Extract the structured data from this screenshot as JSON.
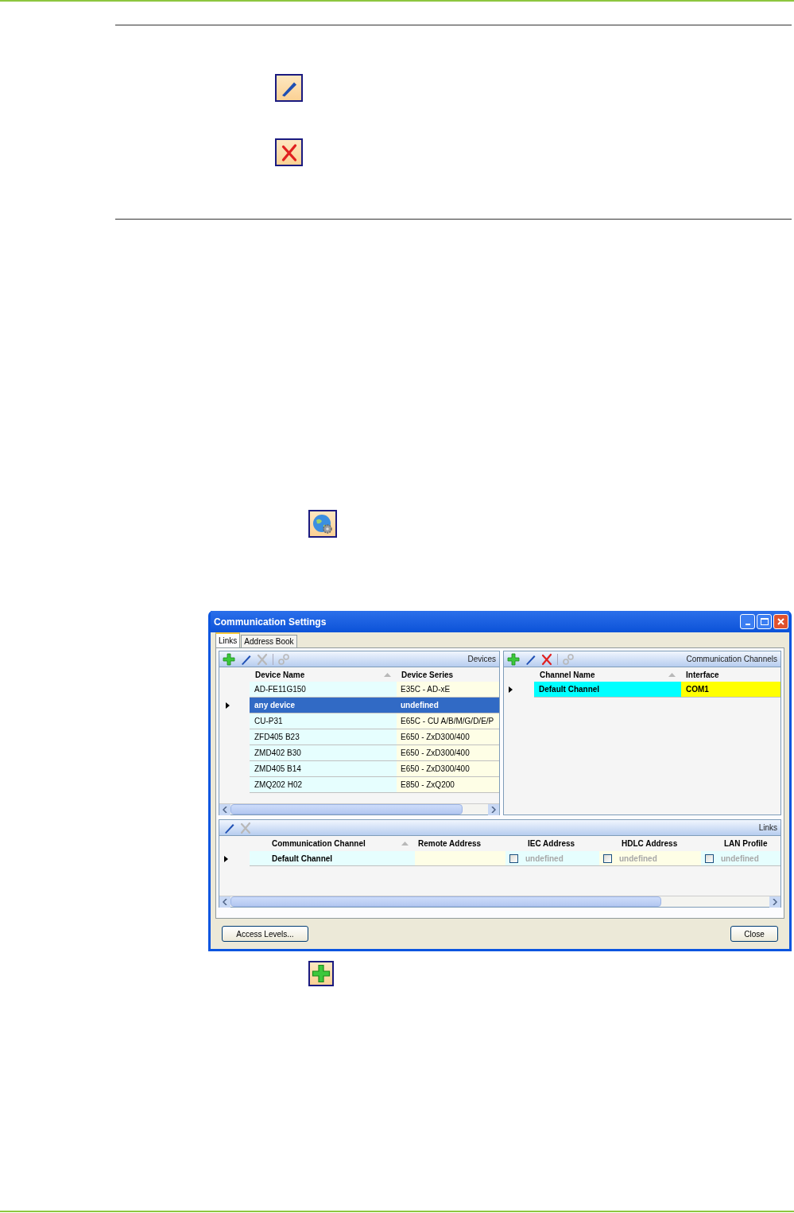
{
  "window": {
    "title": "Communication Settings"
  },
  "tabs": [
    {
      "label": "Links",
      "selected": true
    },
    {
      "label": "Address Book",
      "selected": false
    }
  ],
  "devices": {
    "title": "Devices",
    "toolbar": [
      {
        "kind": "add",
        "disabled": false
      },
      {
        "kind": "edit",
        "disabled": false
      },
      {
        "kind": "delete",
        "disabled": true
      },
      {
        "kind": "link",
        "disabled": true
      }
    ],
    "columns": [
      "Device Name",
      "Device Series"
    ],
    "rows": [
      {
        "name": "AD-FE11G150",
        "series": "E35C - AD-xE",
        "current": false,
        "selected": false
      },
      {
        "name": "any device",
        "series": "undefined",
        "current": true,
        "selected": true
      },
      {
        "name": "CU-P31",
        "series": "E65C - CU A/B/M/G/D/E/P",
        "current": false,
        "selected": false
      },
      {
        "name": "ZFD405 B23",
        "series": "E650 - ZxD300/400",
        "current": false,
        "selected": false
      },
      {
        "name": "ZMD402 B30",
        "series": "E650 - ZxD300/400",
        "current": false,
        "selected": false
      },
      {
        "name": "ZMD405 B14",
        "series": "E650 - ZxD300/400",
        "current": false,
        "selected": false
      },
      {
        "name": "ZMQ202 H02",
        "series": "E850 - ZxQ200",
        "current": false,
        "selected": false
      }
    ]
  },
  "channels": {
    "title": "Communication Channels",
    "toolbar": [
      {
        "kind": "add",
        "disabled": false
      },
      {
        "kind": "edit",
        "disabled": false
      },
      {
        "kind": "delete",
        "disabled": false
      },
      {
        "kind": "link",
        "disabled": true
      }
    ],
    "columns": [
      "Channel Name",
      "Interface"
    ],
    "rows": [
      {
        "name": "Default Channel",
        "interface": "COM1",
        "current": true,
        "selected": false
      }
    ]
  },
  "links": {
    "title": "Links",
    "toolbar": [
      {
        "kind": "edit",
        "disabled": false
      },
      {
        "kind": "delete",
        "disabled": true
      }
    ],
    "columns": [
      "Communication Channel",
      "Remote Address",
      "IEC Address",
      "HDLC Address",
      "LAN Profile"
    ],
    "rows": [
      {
        "channel": "Default Channel",
        "current": true,
        "iec": {
          "checked": false,
          "value": "undefined"
        },
        "hdlc": {
          "checked": false,
          "value": "undefined"
        },
        "lan": {
          "checked": false,
          "value": "undefined"
        }
      }
    ]
  },
  "buttons": [
    "Access Levels...",
    "Close"
  ]
}
